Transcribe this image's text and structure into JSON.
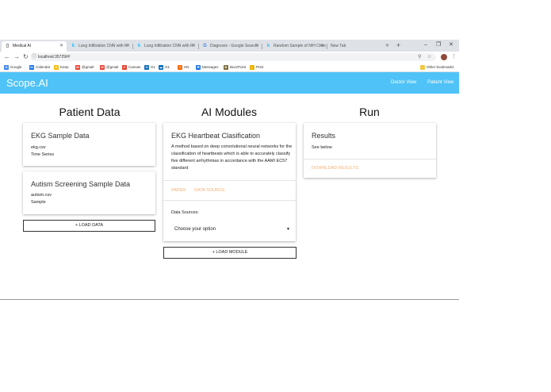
{
  "browser": {
    "tabs": [
      {
        "title": "Medical AI",
        "icon": "page-icon",
        "active": true
      },
      {
        "title": "Lung Infiltration CNN with R",
        "icon": "kaggle-icon",
        "active": false
      },
      {
        "title": "Lung Infiltration CNN with R",
        "icon": "kaggle-icon",
        "active": false
      },
      {
        "title": "Diagnosis - Google Search",
        "icon": "google-icon",
        "active": false
      },
      {
        "title": "Random Sample of NIH Ches",
        "icon": "kaggle-icon",
        "active": false
      },
      {
        "title": "New Tab",
        "icon": "none",
        "active": false
      }
    ],
    "new_tab_symbol": "+",
    "window_controls": {
      "minimize": "–",
      "maximize": "❐",
      "close": "✕"
    },
    "address": "localhost:35729/#!",
    "bookmarks": [
      {
        "label": "Google",
        "color": "#4285f4",
        "glyph": "G"
      },
      {
        "label": "Calendar",
        "color": "#1a73e8",
        "glyph": "31"
      },
      {
        "label": "Keep",
        "color": "#fbbc04",
        "glyph": "K"
      },
      {
        "label": "@gmail",
        "color": "#ea4335",
        "glyph": "M"
      },
      {
        "label": "@gmail",
        "color": "#ea4335",
        "glyph": "M"
      },
      {
        "label": "Canvas",
        "color": "#e13f2b",
        "glyph": "C"
      },
      {
        "label": "G1",
        "color": "#0f6cbd",
        "glyph": "O"
      },
      {
        "label": "G1",
        "color": "#0f6cbd",
        "glyph": "☁"
      },
      {
        "label": "HN",
        "color": "#ff6600",
        "glyph": "Y"
      },
      {
        "label": "Messages",
        "color": "#1a73e8",
        "glyph": "✉"
      },
      {
        "label": "BuzzPoint",
        "color": "#7a6a3a",
        "glyph": "B"
      },
      {
        "label": "Print",
        "color": "#e8b400",
        "glyph": "✋"
      }
    ],
    "other_bookmarks": "Other bookmarks"
  },
  "app": {
    "brand": "Scope.AI",
    "nav": {
      "doctor_view": "Doctor View",
      "patient_view": "Patient View"
    },
    "colors": {
      "primary": "#4fc3f7",
      "accent": "#f2b075"
    }
  },
  "columns": {
    "patient": {
      "title": "Patient Data",
      "cards": [
        {
          "title": "EKG Sample Data",
          "file": "ekg.csv",
          "type": "Time Series"
        },
        {
          "title": "Autism Screening Sample Data",
          "file": "autism.csv",
          "type": "Sample"
        }
      ],
      "button": "+ LOAD DATA"
    },
    "modules": {
      "title": "AI Modules",
      "card": {
        "title": "EKG Heartbeat Clasification",
        "description": "A method based on deep convolutional neural networks for the classification of heartbeats which is able to accurately classify five different arrhythmias in accordance with the AAMI EC57 standard",
        "links": {
          "paper": "PAPER",
          "data_source": "DATA SOURCE"
        },
        "sources_label": "Data Sources:",
        "select_value": "Choose your option",
        "caret": "▼"
      },
      "button": "+ LOAD MODULE"
    },
    "run": {
      "title": "Run",
      "card": {
        "title": "Results",
        "text": "See below",
        "link": "DOWNLOAD RESULTS"
      }
    }
  }
}
